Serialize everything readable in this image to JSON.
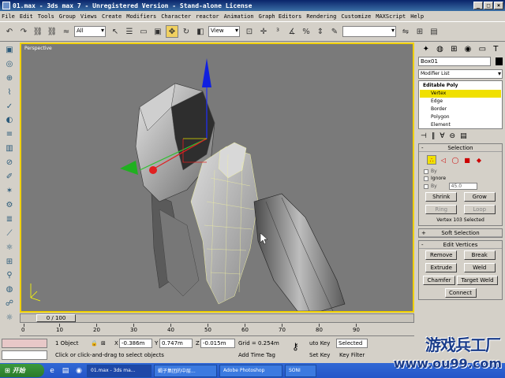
{
  "window": {
    "title": "01.max - 3ds max 7 - Unregistered Version - Stand-alone License"
  },
  "menu": [
    "File",
    "Edit",
    "Tools",
    "Group",
    "Views",
    "Create",
    "Modifiers",
    "Character",
    "reactor",
    "Animation",
    "Graph Editors",
    "Rendering",
    "Customize",
    "MAXScript",
    "Help"
  ],
  "toolbar": {
    "selection_filter": "All",
    "ref_coord": "View"
  },
  "viewport": {
    "label": "Perspective"
  },
  "command_panel": {
    "object_name": "Box01",
    "modifier_list": "Modifier List",
    "stack": {
      "root": "Editable Poly",
      "items": [
        "Vertex",
        "Edge",
        "Border",
        "Polygon",
        "Element"
      ],
      "selected": "Vertex"
    },
    "selection": {
      "title": "Selection",
      "by_label": "By",
      "ignore_label": "Ignore",
      "by_angle_label": "By",
      "angle_value": "45.0",
      "shrink": "Shrink",
      "grow": "Grow",
      "ring": "Ring",
      "loop": "Loop",
      "status": "Vertex 103 Selected"
    },
    "soft_selection": {
      "title": "Soft Selection"
    },
    "edit_vertices": {
      "title": "Edit Vertices",
      "remove": "Remove",
      "break": "Break",
      "extrude": "Extrude",
      "weld": "Weld",
      "chamfer": "Chamfer",
      "target_weld": "Target Weld",
      "connect": "Connect"
    }
  },
  "time": {
    "slider": "0 / 100",
    "ticks": [
      "0",
      "10",
      "20",
      "30",
      "40",
      "50",
      "60",
      "70",
      "80",
      "90"
    ]
  },
  "status": {
    "objects": "1 Object",
    "x_label": "X",
    "x": "-0.386m",
    "y_label": "Y",
    "y": "0.747m",
    "z_label": "Z",
    "z": "-0.015m",
    "grid": "Grid = 0.254m",
    "prompt": "Click or click-and-drag to select objects",
    "add_time_tag": "Add Time Tag",
    "auto_key": "uto Key",
    "set_key": "Set Key",
    "selected": "Selected",
    "key_filters": "Key Filter"
  },
  "taskbar": {
    "start": "开始",
    "tasks": [
      "01.max - 3ds ma...",
      "蝎子集团的中层...",
      "Adobe Photoshop",
      "SONI"
    ]
  },
  "watermark": {
    "line1": "游戏兵工厂",
    "line2": "www.ou99.com"
  },
  "colors": {
    "viewport_bg": "#7a7a7a",
    "active_border": "#f0d000",
    "selection_highlight": "#f0e000"
  }
}
